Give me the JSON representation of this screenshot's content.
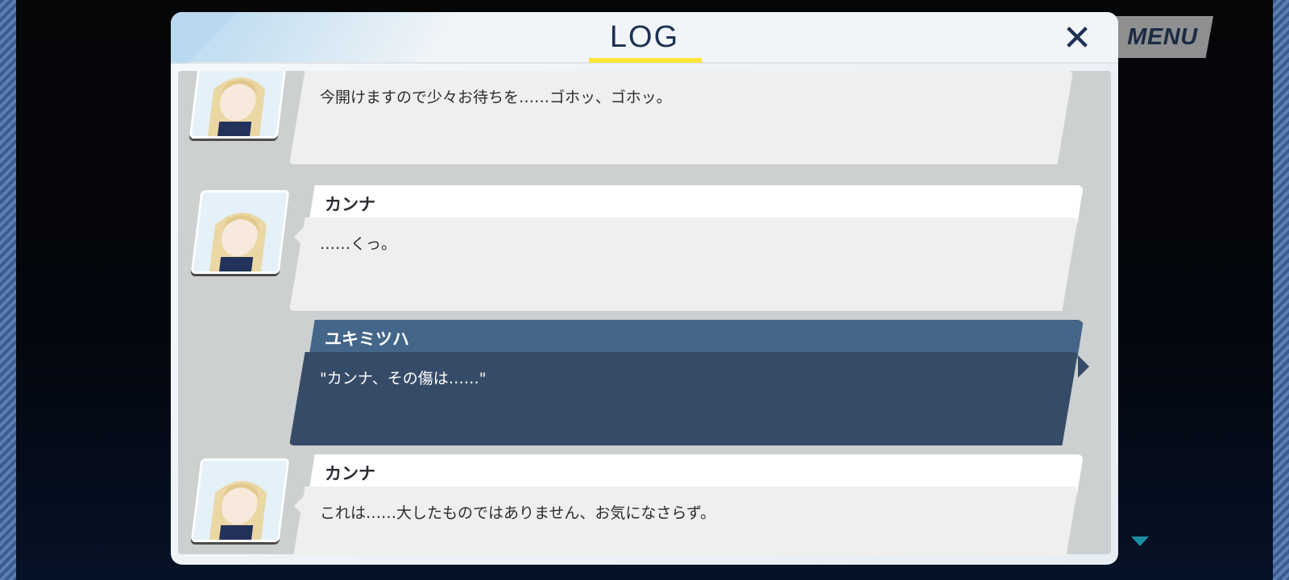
{
  "colors": {
    "accent_underline": "#ffe23a",
    "header_text": "#1e3252",
    "player_message_bg": "#364b67",
    "player_name_bg": "#44668a",
    "npc_message_bg": "#efefed"
  },
  "menu": {
    "label": "MENU"
  },
  "log_panel": {
    "title": "LOG",
    "close_icon": "close-icon",
    "scroll_icon": "scroll-down-icon"
  },
  "messages": [
    {
      "speaker": "",
      "text": "今開けますので少々お待ちを……ゴホッ、ゴホッ。",
      "has_portrait": true
    },
    {
      "speaker": "カンナ",
      "text": "……くっ。",
      "has_portrait": true
    },
    {
      "speaker": "ユキミツハ",
      "text": "\"カンナ、その傷は……\"",
      "has_portrait": false
    },
    {
      "speaker": "カンナ",
      "text": "これは……大したものではありません、お気になさらず。",
      "has_portrait": true
    }
  ]
}
